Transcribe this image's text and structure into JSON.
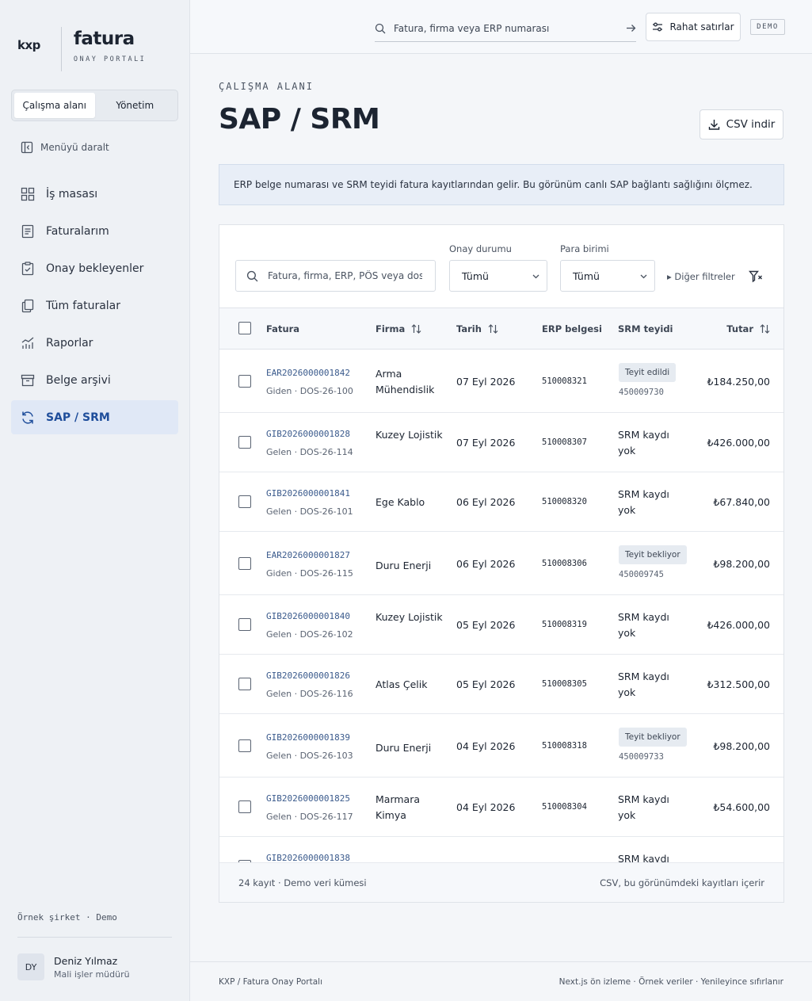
{
  "brand": {
    "short": "kxp",
    "name": "fatura",
    "subtitle": "ONAY PORTALI"
  },
  "sidebar": {
    "segments": [
      "Çalışma alanı",
      "Yönetim"
    ],
    "collapse_label": "Menüyü daralt",
    "items": [
      {
        "label": "İş masası",
        "icon": "grid-icon"
      },
      {
        "label": "Faturalarım",
        "icon": "document-icon"
      },
      {
        "label": "Onay bekleyenler",
        "icon": "clipboard-check-icon"
      },
      {
        "label": "Tüm faturalar",
        "icon": "files-icon"
      },
      {
        "label": "Raporlar",
        "icon": "chart-icon"
      },
      {
        "label": "Belge arşivi",
        "icon": "archive-icon"
      },
      {
        "label": "SAP / SRM",
        "icon": "sync-icon"
      }
    ],
    "company": "Örnek şirket · Demo",
    "user": {
      "initials": "DY",
      "name": "Deniz Yılmaz",
      "role": "Mali işler müdürü"
    }
  },
  "topbar": {
    "search_placeholder": "Fatura, firma veya ERP numarası",
    "density_label": "Rahat satırlar",
    "badge": "DEMO"
  },
  "page": {
    "breadcrumb": "ÇALIŞMA ALANI",
    "title": "SAP / SRM",
    "csv_label": "CSV indir",
    "note": "ERP belge numarası ve SRM teyidi fatura kayıtlarından gelir. Bu görünüm canlı SAP bağlantı sağlığını ölçmez."
  },
  "filters": {
    "search_placeholder": "Fatura, firma, ERP, PÖS veya dosya no",
    "status_label": "Onay durumu",
    "status_value": "Tümü",
    "currency_label": "Para birimi",
    "currency_value": "Tümü",
    "more_label": "▸ Diğer filtreler"
  },
  "table": {
    "headers": {
      "invoice": "Fatura",
      "firm": "Firma",
      "date": "Tarih",
      "erp": "ERP belgesi",
      "srm": "SRM teyidi",
      "amount": "Tutar"
    },
    "rows": [
      {
        "invoice": "EAR2026000001842",
        "sub": "Giden · DOS-26-100",
        "firm": "Arma Mühendislik",
        "date": "07 Eyl 2026",
        "erp": "510008321",
        "srm": "Teyit edildi",
        "srm_ref": "450009730",
        "amount": "₺184.250,00"
      },
      {
        "invoice": "GIB2026000001828",
        "sub": "Gelen · DOS-26-114",
        "firm": "Kuzey Lojistik",
        "date": "07 Eyl 2026",
        "erp": "510008307",
        "srm": "SRM kaydı yok",
        "srm_ref": "",
        "amount": "₺426.000,00"
      },
      {
        "invoice": "GIB2026000001841",
        "sub": "Gelen · DOS-26-101",
        "firm": "Ege Kablo",
        "date": "06 Eyl 2026",
        "erp": "510008320",
        "srm": "SRM kaydı yok",
        "srm_ref": "",
        "amount": "₺67.840,00"
      },
      {
        "invoice": "EAR2026000001827",
        "sub": "Giden · DOS-26-115",
        "firm": "Duru Enerji",
        "date": "06 Eyl 2026",
        "erp": "510008306",
        "srm": "Teyit bekliyor",
        "srm_ref": "450009745",
        "amount": "₺98.200,00"
      },
      {
        "invoice": "GIB2026000001840",
        "sub": "Gelen · DOS-26-102",
        "firm": "Kuzey Lojistik",
        "date": "05 Eyl 2026",
        "erp": "510008319",
        "srm": "SRM kaydı yok",
        "srm_ref": "",
        "amount": "₺426.000,00"
      },
      {
        "invoice": "GIB2026000001826",
        "sub": "Gelen · DOS-26-116",
        "firm": "Atlas Çelik",
        "date": "05 Eyl 2026",
        "erp": "510008305",
        "srm": "SRM kaydı yok",
        "srm_ref": "",
        "amount": "₺312.500,00"
      },
      {
        "invoice": "GIB2026000001839",
        "sub": "Gelen · DOS-26-103",
        "firm": "Duru Enerji",
        "date": "04 Eyl 2026",
        "erp": "510008318",
        "srm": "Teyit bekliyor",
        "srm_ref": "450009733",
        "amount": "₺98.200,00"
      },
      {
        "invoice": "GIB2026000001825",
        "sub": "Gelen · DOS-26-117",
        "firm": "Marmara Kimya",
        "date": "04 Eyl 2026",
        "erp": "510008304",
        "srm": "SRM kaydı yok",
        "srm_ref": "",
        "amount": "₺54.600,00"
      },
      {
        "invoice": "GIB2026000001838",
        "sub": "",
        "firm": "",
        "date": "",
        "erp": "",
        "srm": "SRM kaydı",
        "srm_ref": "",
        "amount": ""
      }
    ],
    "footer_left": "24 kayıt · Demo veri kümesi",
    "footer_right": "CSV, bu görünümdeki kayıtları içerir"
  },
  "footer": {
    "left": "KXP / Fatura Onay Portalı",
    "right": "Next.js ön izleme · Örnek veriler · Yenileyince sıfırlanır"
  }
}
